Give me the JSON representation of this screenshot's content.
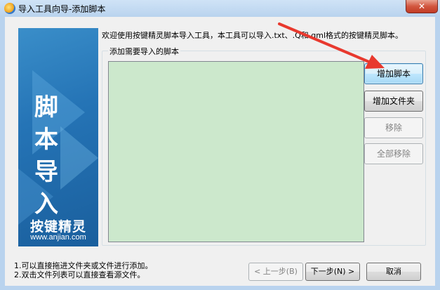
{
  "window": {
    "title": "导入工具向导-添加脚本",
    "close_label": "✕"
  },
  "banner": {
    "title_chars": [
      "脚",
      "本",
      "导",
      "入"
    ],
    "brand": "按键精灵",
    "url": "www.anjian.com"
  },
  "intro": "欢迎使用按键精灵脚本导入工具，本工具可以导入.txt、.Q和.qml格式的按键精灵脚本。",
  "group_label": "添加需要导入的脚本",
  "buttons": {
    "add_script": "增加脚本",
    "add_folder": "增加文件夹",
    "remove": "移除",
    "remove_all": "全部移除",
    "prev": "< 上一步(B)",
    "next": "下一步(N) >",
    "cancel": "取消"
  },
  "hints": [
    "1.可以直接拖进文件夹或文件进行添加。",
    "2.双击文件列表可以直接查看源文件。"
  ],
  "colors": {
    "list_bg": "#cce8cc",
    "banner_blue": "#2574b6",
    "annotation_arrow": "#e8392e"
  }
}
